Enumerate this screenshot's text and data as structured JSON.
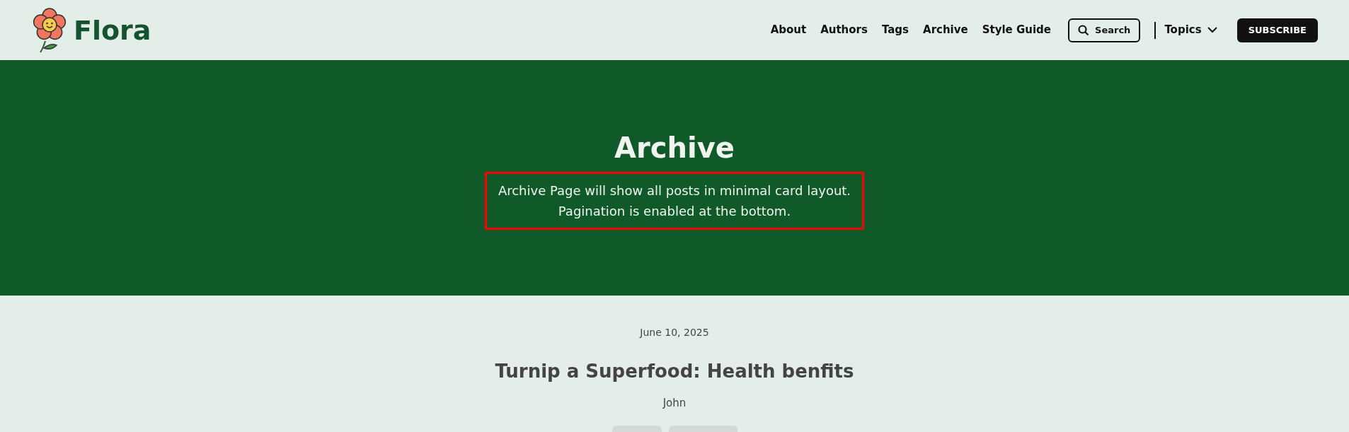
{
  "header": {
    "logo_text": "Flora",
    "nav": [
      {
        "label": "About"
      },
      {
        "label": "Authors"
      },
      {
        "label": "Tags"
      },
      {
        "label": "Archive"
      },
      {
        "label": "Style Guide"
      }
    ],
    "search_button": "Search",
    "topics_menu": "Topics",
    "subscribe_button": "SUBSCRIBE"
  },
  "hero": {
    "title": "Archive",
    "description": {
      "lines": [
        "Archive Page will show all posts in minimal card layout.",
        "Pagination is enabled at the bottom."
      ],
      "highlighted": true
    }
  },
  "posts": [
    {
      "date": "June 10, 2025",
      "title": "Turnip a Superfood: Health benfits",
      "author": "John",
      "tags": [
        {
          "kind": "short"
        },
        {
          "kind": "long"
        }
      ]
    }
  ]
}
